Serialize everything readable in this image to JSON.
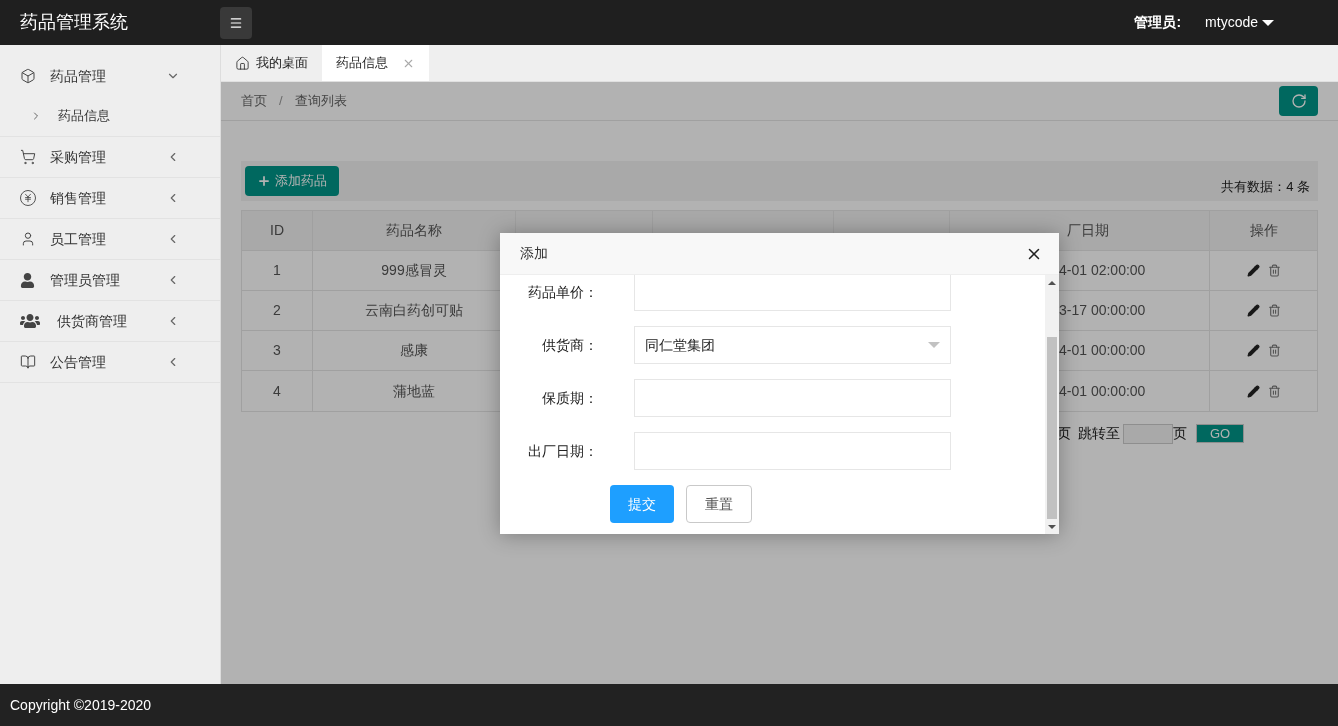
{
  "header": {
    "title": "药品管理系统",
    "admin_label": "管理员:",
    "admin_name": "mtycode"
  },
  "sidebar": {
    "items": [
      {
        "label": "药品管理",
        "expanded": true,
        "children": [
          {
            "label": "药品信息"
          }
        ]
      },
      {
        "label": "采购管理",
        "expanded": false
      },
      {
        "label": "销售管理",
        "expanded": false
      },
      {
        "label": "员工管理",
        "expanded": false
      },
      {
        "label": "管理员管理",
        "expanded": false
      },
      {
        "label": "供货商管理",
        "expanded": false
      },
      {
        "label": "公告管理",
        "expanded": false
      }
    ]
  },
  "tabs": [
    {
      "label": "我的桌面",
      "selected": false,
      "kind": "home"
    },
    {
      "label": "药品信息",
      "selected": true,
      "kind": "closable"
    }
  ],
  "breadcrumb": {
    "items": [
      "首页",
      "查询列表"
    ],
    "separator": "/"
  },
  "toolbar": {
    "add_button": "添加药品",
    "total": "共有数据：4 条"
  },
  "table": {
    "columns": [
      "ID",
      "药品名称",
      "厂日期",
      "操作"
    ],
    "rows": [
      {
        "id": "1",
        "name": "999感冒灵",
        "date": "4-01 02:00:00"
      },
      {
        "id": "2",
        "name": "云南白药创可贴",
        "date": "3-17 00:00:00"
      },
      {
        "id": "3",
        "name": "感康",
        "date": "4-01 00:00:00"
      },
      {
        "id": "4",
        "name": "蒲地蓝",
        "date": "4-01 00:00:00"
      }
    ]
  },
  "pagination": {
    "page_suffix": "页",
    "jump_label": "跳转至",
    "page_unit": "页",
    "go": "GO"
  },
  "modal": {
    "title": "添加",
    "fields": [
      {
        "label": "药品单价：",
        "kind": "input"
      },
      {
        "label": "供货商：",
        "kind": "select",
        "value": "同仁堂集团"
      },
      {
        "label": "保质期：",
        "kind": "input"
      },
      {
        "label": "出厂日期：",
        "kind": "input"
      }
    ],
    "submit": "提交",
    "reset": "重置"
  },
  "footer": {
    "copyright": "Copyright ©2019-2020"
  }
}
